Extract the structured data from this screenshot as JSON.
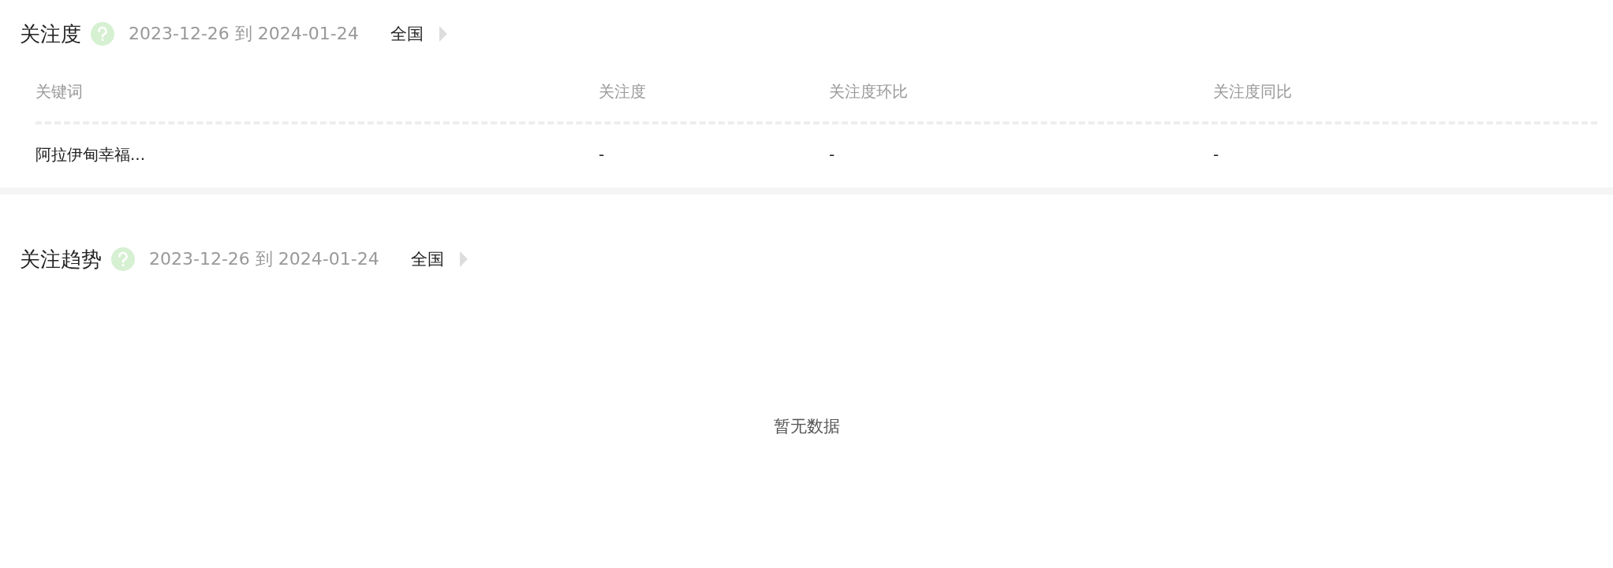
{
  "attention": {
    "title": "关注度",
    "date_range": "2023-12-26 到 2024-01-24",
    "region": "全国",
    "table": {
      "columns": [
        "关键词",
        "关注度",
        "关注度环比",
        "关注度同比"
      ],
      "rows": [
        [
          "阿拉伊甸幸福...",
          "-",
          "-",
          "-"
        ]
      ]
    }
  },
  "trend": {
    "title": "关注趋势",
    "date_range": "2023-12-26 到 2024-01-24",
    "region": "全国",
    "empty_message": "暂无数据"
  }
}
